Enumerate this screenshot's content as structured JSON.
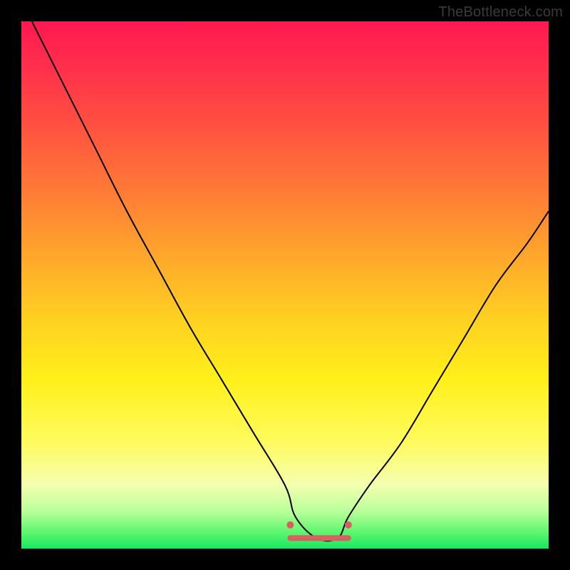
{
  "watermark": "TheBottleneck.com",
  "chart_data": {
    "type": "line",
    "title": "",
    "xlabel": "",
    "ylabel": "",
    "xlim": [
      0,
      100
    ],
    "ylim": [
      0,
      100
    ],
    "grid": false,
    "legend": false,
    "gradient_stops": [
      {
        "pct": 0,
        "color": "#ff1850"
      },
      {
        "pct": 8,
        "color": "#ff2e4c"
      },
      {
        "pct": 20,
        "color": "#ff5140"
      },
      {
        "pct": 32,
        "color": "#ff7a36"
      },
      {
        "pct": 44,
        "color": "#ffa52c"
      },
      {
        "pct": 56,
        "color": "#ffcf22"
      },
      {
        "pct": 68,
        "color": "#fff01a"
      },
      {
        "pct": 80,
        "color": "#fffb60"
      },
      {
        "pct": 88,
        "color": "#f3ffb0"
      },
      {
        "pct": 93,
        "color": "#b8ff98"
      },
      {
        "pct": 97,
        "color": "#5cf56e"
      },
      {
        "pct": 100,
        "color": "#18e864"
      }
    ],
    "series": [
      {
        "name": "bottleneck-curve",
        "color": "#000000",
        "stroke_width": 2,
        "x": [
          2,
          8,
          14,
          20,
          26,
          32,
          38,
          44,
          50,
          52,
          56,
          60,
          62,
          66,
          72,
          78,
          84,
          90,
          96,
          100
        ],
        "y": [
          100,
          88,
          76,
          64,
          53,
          42,
          32,
          22,
          12,
          6,
          2,
          2,
          6,
          12,
          20,
          30,
          40,
          50,
          58,
          64
        ]
      },
      {
        "name": "flat-segment",
        "color": "#d6605f",
        "stroke_width": 8,
        "linecap": "round",
        "x": [
          51,
          62
        ],
        "y": [
          2,
          2
        ]
      }
    ],
    "markers": [
      {
        "name": "left-endpoint",
        "x": 51,
        "y": 4.5,
        "r": 5,
        "color": "#d6605f"
      },
      {
        "name": "right-endpoint",
        "x": 62,
        "y": 4.5,
        "r": 5,
        "color": "#d6605f"
      }
    ]
  }
}
